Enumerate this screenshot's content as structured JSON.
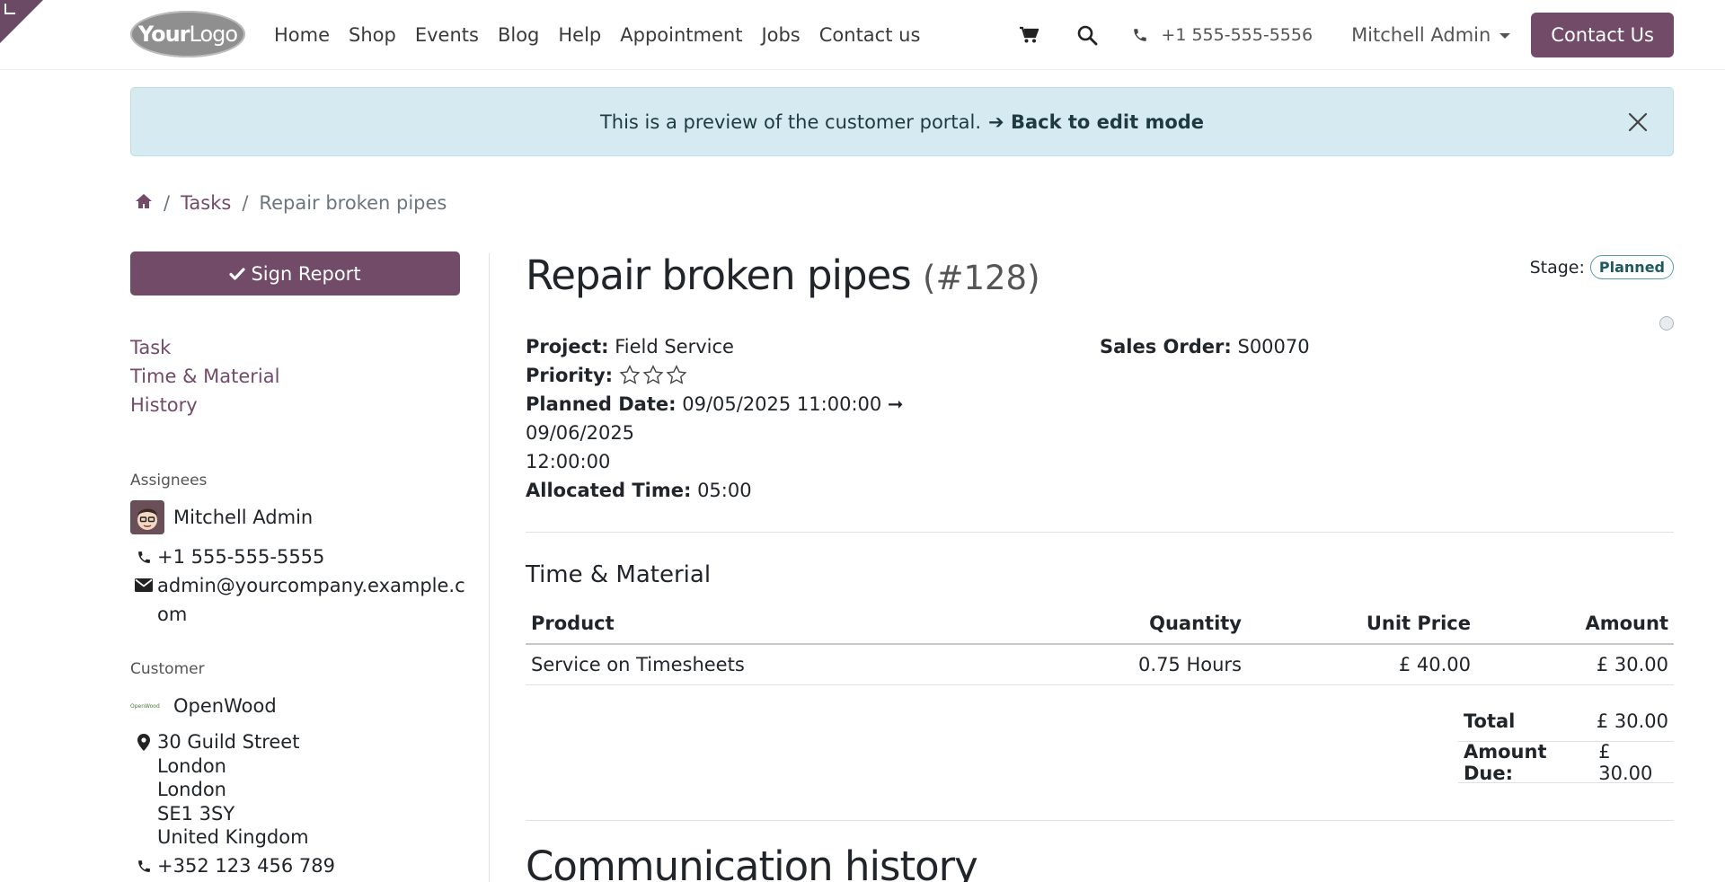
{
  "header": {
    "logo_bold": "Your",
    "logo_light": "Logo",
    "nav": [
      "Home",
      "Shop",
      "Events",
      "Blog",
      "Help",
      "Appointment",
      "Jobs",
      "Contact us"
    ],
    "phone": "+1 555-555-5556",
    "user": "Mitchell Admin",
    "contact_button": "Contact Us"
  },
  "alert": {
    "text": "This is a preview of the customer portal.",
    "link": "➔ Back to edit mode"
  },
  "breadcrumb": {
    "tasks": "Tasks",
    "current": "Repair broken pipes"
  },
  "sidebar": {
    "sign_button": "Sign Report",
    "nav": [
      "Task",
      "Time & Material",
      "History"
    ],
    "assignees_label": "Assignees",
    "assignee_name": "Mitchell Admin",
    "assignee_phone": "+1 555-555-5555",
    "assignee_email_1": "admin@yourcompany.example.c",
    "assignee_email_2": "om",
    "customer_label": "Customer",
    "customer_name": "OpenWood",
    "customer_logo_text": "OpenWood",
    "address": [
      "30 Guild Street",
      "London",
      "London",
      "SE1 3SY",
      "United Kingdom"
    ],
    "customer_phone": "+352 123 456 789"
  },
  "task": {
    "title": "Repair broken pipes",
    "number": "(#128)",
    "stage_label": "Stage:",
    "stage": "Planned",
    "project_label": "Project:",
    "project": "Field Service",
    "priority_label": "Priority:",
    "priority_stars": 0,
    "planned_label": "Planned Date:",
    "planned_1": "09/05/2025 11:00:00 ➞ 09/06/2025",
    "planned_2": "12:00:00",
    "allocated_label": "Allocated Time:",
    "allocated": "05:00",
    "sales_label": "Sales Order:",
    "sales_order": "S00070"
  },
  "time_material": {
    "title": "Time & Material",
    "headers": [
      "Product",
      "Quantity",
      "Unit Price",
      "Amount"
    ],
    "rows": [
      [
        "Service on Timesheets",
        "0.75 Hours",
        "£ 40.00",
        "£ 30.00"
      ]
    ],
    "total_label": "Total",
    "total": "£ 30.00",
    "due_label": "Amount Due:",
    "due": "£ 30.00"
  },
  "communication": {
    "title": "Communication history"
  },
  "colors": {
    "brand": "#714b67",
    "alert_bg": "#d6ebf1"
  }
}
